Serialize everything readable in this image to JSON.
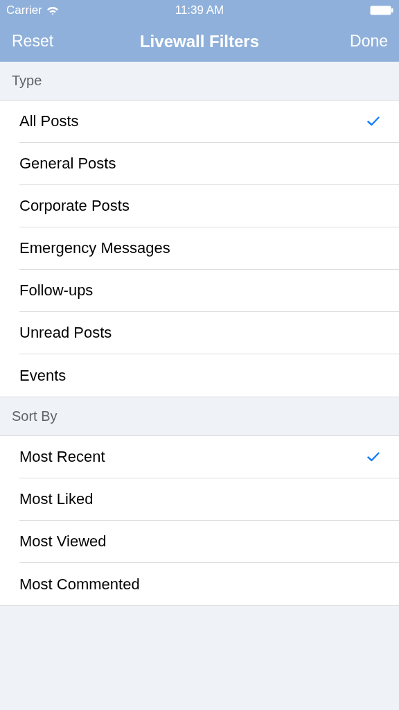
{
  "status_bar": {
    "carrier": "Carrier",
    "time": "11:39 AM"
  },
  "nav_bar": {
    "left_button": "Reset",
    "title": "Livewall Filters",
    "right_button": "Done"
  },
  "sections": [
    {
      "header": "Type",
      "items": [
        {
          "label": "All Posts",
          "selected": true
        },
        {
          "label": "General Posts",
          "selected": false
        },
        {
          "label": "Corporate Posts",
          "selected": false
        },
        {
          "label": "Emergency Messages",
          "selected": false
        },
        {
          "label": "Follow-ups",
          "selected": false
        },
        {
          "label": "Unread Posts",
          "selected": false
        },
        {
          "label": "Events",
          "selected": false
        }
      ]
    },
    {
      "header": "Sort By",
      "items": [
        {
          "label": "Most Recent",
          "selected": true
        },
        {
          "label": "Most Liked",
          "selected": false
        },
        {
          "label": "Most Viewed",
          "selected": false
        },
        {
          "label": "Most Commented",
          "selected": false
        }
      ]
    }
  ]
}
